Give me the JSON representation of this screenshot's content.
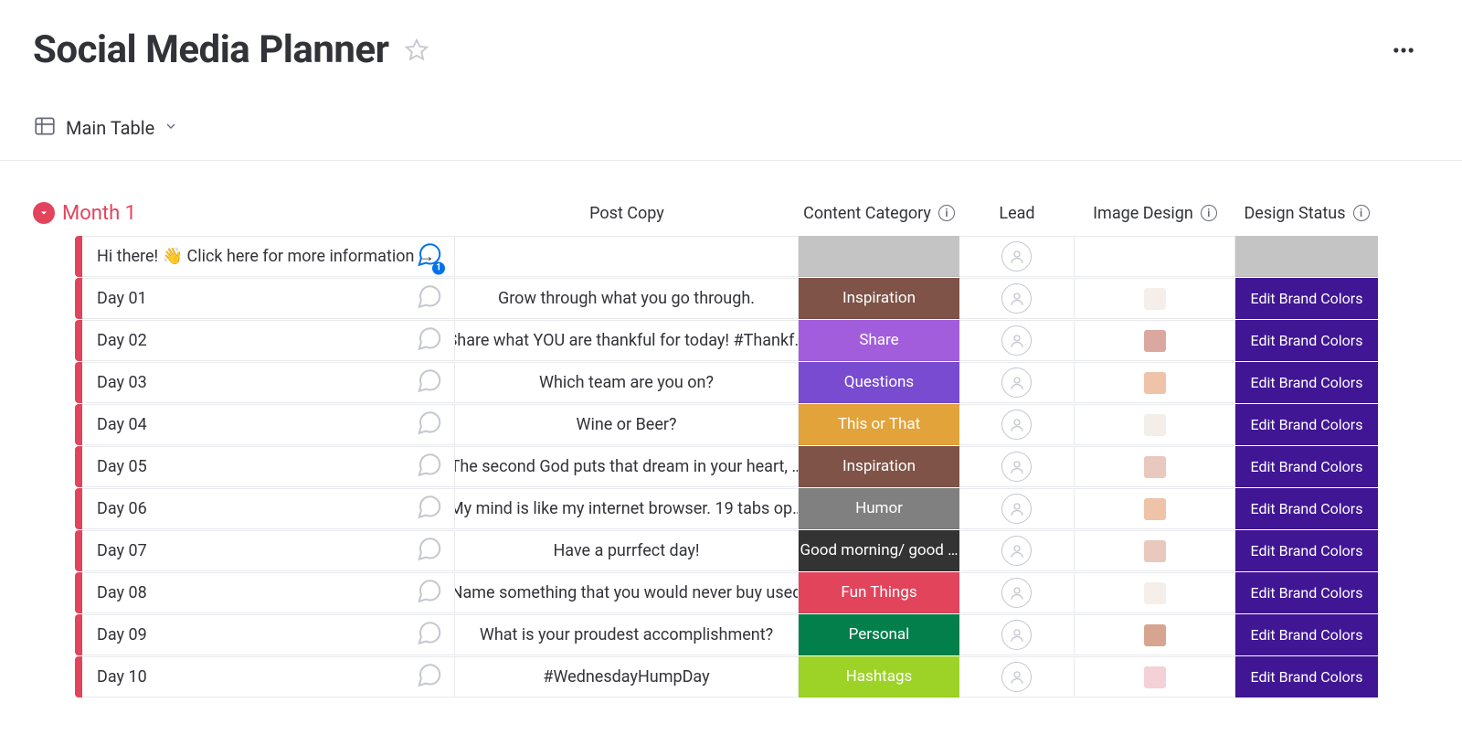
{
  "page_title": "Social Media Planner",
  "view_name": "Main Table",
  "group_title": "Month 1",
  "columns": {
    "post_copy": "Post Copy",
    "content_category": "Content Category",
    "lead": "Lead",
    "image_design": "Image Design",
    "design_status": "Design Status"
  },
  "design_status_default": {
    "label": "Edit Brand Colors",
    "color": "#401694"
  },
  "category_colors": {
    "Inspiration": "#7f5347",
    "Share": "#a25ddc",
    "Questions": "#784bd1",
    "This or That": "#e2a33a",
    "Humor": "#808080",
    "Good morning/ good night": "#333333",
    "Fun Things": "#e2445c",
    "Personal": "#037f4c",
    "Hashtags": "#9cd326",
    "_empty": "#c4c4c4"
  },
  "thumb_colors": [
    "#f6eee9",
    "#dba8a0",
    "#eec3a8",
    "#f3efe8",
    "#e9c8bd",
    "#eec3a8",
    "#e9c8bd",
    "#f6eee9",
    "#d7a58f",
    "#f3d1d7"
  ],
  "rows": [
    {
      "name": "Hi there! 👋 Click here for more information →",
      "post": "",
      "cat": "",
      "thumb": false,
      "status": false,
      "notify": true
    },
    {
      "name": "Day 01",
      "post": "Grow through what you go through.",
      "cat": "Inspiration",
      "thumb": true,
      "status": true
    },
    {
      "name": "Day 02",
      "post": "Share what YOU are thankful for today! #Thankf…",
      "cat": "Share",
      "thumb": true,
      "status": true
    },
    {
      "name": "Day 03",
      "post": "Which team are you on?",
      "cat": "Questions",
      "thumb": true,
      "status": true
    },
    {
      "name": "Day 04",
      "post": "Wine or Beer?",
      "cat": "This or That",
      "thumb": true,
      "status": true
    },
    {
      "name": "Day 05",
      "post": "The second God puts that dream in your heart, …",
      "cat": "Inspiration",
      "thumb": true,
      "status": true
    },
    {
      "name": "Day 06",
      "post": "My mind is like my internet browser. 19 tabs op…",
      "cat": "Humor",
      "thumb": true,
      "status": true
    },
    {
      "name": "Day 07",
      "post": "Have a purrfect day!",
      "cat": "Good morning/ good night",
      "thumb": true,
      "status": true
    },
    {
      "name": "Day 08",
      "post": "Name something that you would never buy used",
      "cat": "Fun Things",
      "thumb": true,
      "status": true
    },
    {
      "name": "Day 09",
      "post": "What is your proudest accomplishment?",
      "cat": "Personal",
      "thumb": true,
      "status": true
    },
    {
      "name": "Day 10",
      "post": "#WednesdayHumpDay",
      "cat": "Hashtags",
      "thumb": true,
      "status": true
    }
  ]
}
